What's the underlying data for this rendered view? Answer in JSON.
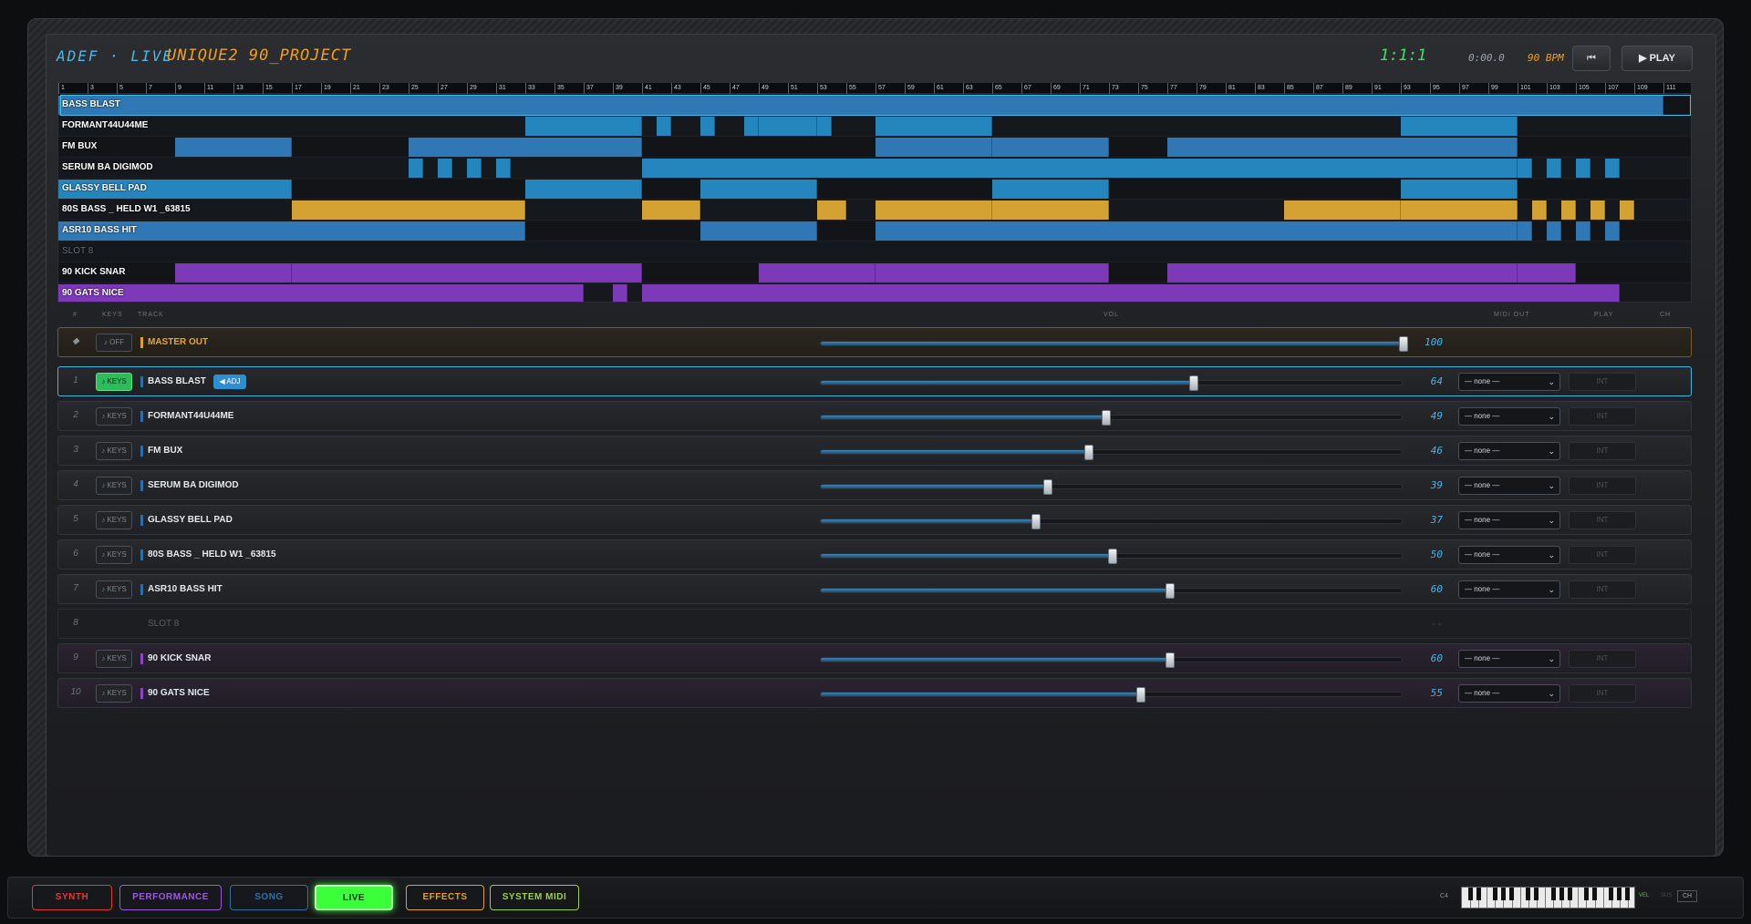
{
  "header": {
    "logo": "ADEF · LIVE",
    "project": "UNIQUE2 90_PROJECT",
    "position": "1:1:1",
    "time": "0:00.0",
    "bpm": "90 BPM",
    "rewind_label": "⏮",
    "play_label": "▶ PLAY"
  },
  "ruler": {
    "ticks": [
      "1",
      "3",
      "5",
      "7",
      "9",
      "11",
      "13",
      "15",
      "17",
      "19",
      "21",
      "23",
      "25",
      "27",
      "29",
      "31",
      "33",
      "35",
      "37",
      "39",
      "41",
      "43",
      "45",
      "47",
      "49",
      "51",
      "53",
      "55",
      "57",
      "59",
      "61",
      "63",
      "65",
      "67",
      "69",
      "71",
      "73",
      "75",
      "77",
      "79",
      "81",
      "83",
      "85",
      "87",
      "89",
      "91",
      "93",
      "95",
      "97",
      "99",
      "101",
      "103",
      "105",
      "107",
      "109",
      "111"
    ]
  },
  "lanes": [
    {
      "name": "BASS BLAST",
      "color": "blue"
    },
    {
      "name": "FORMANT44U44ME",
      "color": "teal"
    },
    {
      "name": "FM BUX",
      "color": "blue"
    },
    {
      "name": "SERUM BA DIGIMOD",
      "color": "teal"
    },
    {
      "name": "GLASSY BELL PAD",
      "color": "teal"
    },
    {
      "name": "80S BASS _ HELD W1 _63815",
      "color": "amber"
    },
    {
      "name": "ASR10 BASS HIT",
      "color": "blue"
    },
    {
      "name": "SLOT 8",
      "color": "none"
    },
    {
      "name": "90 KICK SNAR",
      "color": "purple"
    },
    {
      "name": "90 GATS NICE",
      "color": "purple"
    }
  ],
  "columns": {
    "num": "#",
    "keys": "KEYS",
    "track": "TRACK",
    "vol": "VOL",
    "midi_out": "MIDI OUT",
    "play": "PLAY",
    "ch": "CH"
  },
  "master": {
    "icon": "◆",
    "keys": "♪ OFF",
    "name": "MASTER OUT",
    "volume": 100
  },
  "tracks": [
    {
      "num": "1",
      "keys": "♪ KEYS",
      "name": "BASS BLAST",
      "adj": "◀ ADJ",
      "volume": 64,
      "midi": "— none —",
      "play": "INT"
    },
    {
      "num": "2",
      "keys": "♪ KEYS",
      "name": "FORMANT44U44ME",
      "volume": 49,
      "midi": "— none —",
      "play": "INT"
    },
    {
      "num": "3",
      "keys": "♪ KEYS",
      "name": "FM BUX",
      "volume": 46,
      "midi": "— none —",
      "play": "INT"
    },
    {
      "num": "4",
      "keys": "♪ KEYS",
      "name": "SERUM BA DIGIMOD",
      "volume": 39,
      "midi": "— none —",
      "play": "INT"
    },
    {
      "num": "5",
      "keys": "♪ KEYS",
      "name": "GLASSY BELL PAD",
      "volume": 37,
      "midi": "— none —",
      "play": "INT"
    },
    {
      "num": "6",
      "keys": "♪ KEYS",
      "name": "80S BASS _ HELD W1 _63815",
      "volume": 50,
      "midi": "— none —",
      "play": "INT"
    },
    {
      "num": "7",
      "keys": "♪ KEYS",
      "name": "ASR10 BASS HIT",
      "volume": 60,
      "midi": "— none —",
      "play": "INT"
    },
    {
      "num": "8",
      "name": "SLOT 8",
      "empty_value": "--"
    },
    {
      "num": "9",
      "keys": "♪ KEYS",
      "name": "90 KICK SNAR",
      "volume": 60,
      "midi": "— none —",
      "play": "INT"
    },
    {
      "num": "10",
      "keys": "♪ KEYS",
      "name": "90 GATS NICE",
      "volume": 55,
      "midi": "— none —",
      "play": "INT"
    }
  ],
  "bottom_tabs": [
    {
      "label": "SYNTH",
      "color": "#e03a3a"
    },
    {
      "label": "PERFORMANCE",
      "color": "#9a5ae0"
    },
    {
      "label": "SONG",
      "color": "#2e6fa8"
    },
    {
      "label": "LIVE",
      "color": "#3cff3c",
      "active": true
    },
    {
      "label": "EFFECTS",
      "color": "#e0a030"
    },
    {
      "label": "SYSTEM MIDI",
      "color": "#9ad040"
    }
  ],
  "keyboard": {
    "octave": "C4",
    "vel": "VEL",
    "sus": "SUS",
    "ch": "CH"
  }
}
